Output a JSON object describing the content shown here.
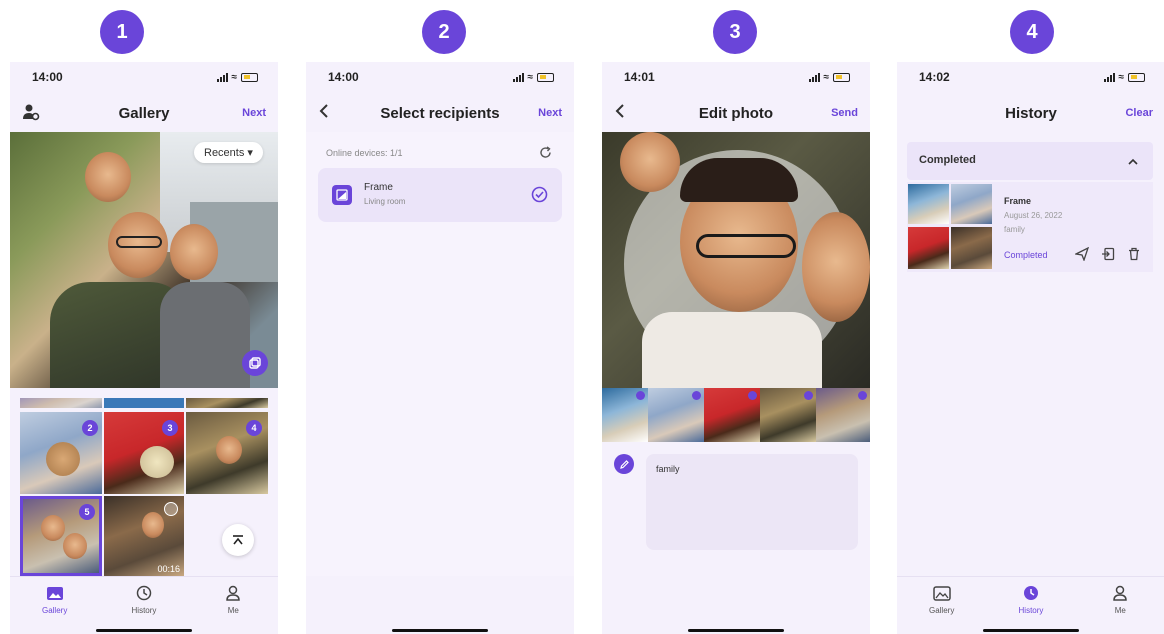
{
  "steps": [
    "1",
    "2",
    "3",
    "4"
  ],
  "accent_color": "#6a45d9",
  "screens": {
    "gallery": {
      "time": "14:00",
      "title": "Gallery",
      "next_label": "Next",
      "recents_label": "Recents",
      "video_duration": "00:16",
      "badges": [
        "2",
        "3",
        "4",
        "5"
      ]
    },
    "recipients": {
      "time": "14:00",
      "title": "Select recipients",
      "next_label": "Next",
      "online_devices": "Online devices: 1/1",
      "device_name": "Frame",
      "device_location": "Living room"
    },
    "edit": {
      "time": "14:01",
      "title": "Edit photo",
      "send_label": "Send",
      "caption": "family"
    },
    "history": {
      "time": "14:02",
      "title": "History",
      "clear_label": "Clear",
      "section_label": "Completed",
      "entry": {
        "device": "Frame",
        "date": "August 26, 2022",
        "caption": "family",
        "status": "Completed"
      }
    }
  },
  "tabs": {
    "gallery": "Gallery",
    "history": "History",
    "me": "Me"
  },
  "icons": [
    "account-settings-icon",
    "caret-down-icon",
    "select-multiple-icon",
    "scroll-top-icon",
    "gallery-icon",
    "history-icon",
    "me-icon",
    "back-icon",
    "frame-device-icon",
    "checkmark-icon",
    "refresh-icon",
    "edit-caption-icon",
    "chevron-up-icon",
    "send-icon",
    "export-icon",
    "trash-icon"
  ]
}
